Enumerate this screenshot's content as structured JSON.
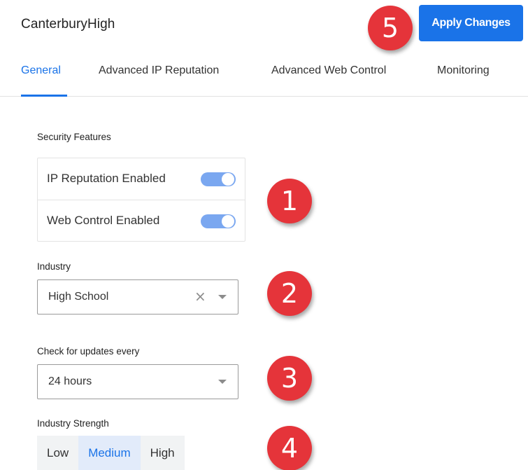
{
  "header": {
    "title": "CanterburyHigh",
    "apply_label": "Apply Changes"
  },
  "tabs": [
    {
      "label": "General",
      "active": true
    },
    {
      "label": "Advanced IP Reputation",
      "active": false
    },
    {
      "label": "Advanced Web Control",
      "active": false
    },
    {
      "label": "Monitoring",
      "active": false
    }
  ],
  "security": {
    "label": "Security Features",
    "features": [
      {
        "label": "IP Reputation Enabled",
        "enabled": true
      },
      {
        "label": "Web Control Enabled",
        "enabled": true
      }
    ]
  },
  "industry": {
    "label": "Industry",
    "value": "High School",
    "clear_glyph": "×"
  },
  "updates": {
    "label": "Check for updates every",
    "value": "24 hours"
  },
  "strength": {
    "label": "Industry Strength",
    "options": [
      "Low",
      "Medium",
      "High"
    ],
    "selected": "Medium"
  },
  "callouts": [
    "1",
    "2",
    "3",
    "4",
    "5"
  ],
  "colors": {
    "accent": "#1a73e8",
    "toggle_on": "#7aa7f0",
    "callout": "#e5343a",
    "segment_selected_bg": "#e2ebfa"
  }
}
